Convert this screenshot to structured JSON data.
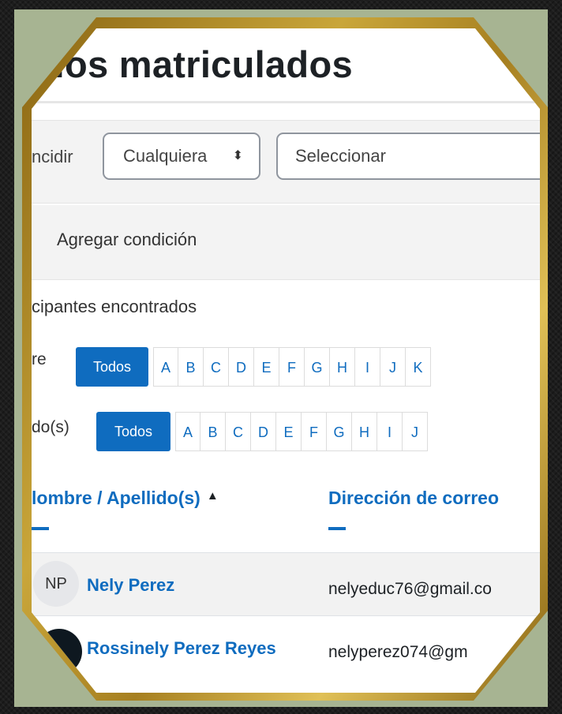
{
  "page": {
    "title": "rios matriculados"
  },
  "filter": {
    "match_label": "ncidir",
    "match_select_value": "Cualquiera",
    "condition_select_value": "Seleccionar",
    "add_condition": "Agregar condición"
  },
  "participants": {
    "found_text": "cipantes encontrados",
    "first_name_label": "re",
    "last_name_label": "do(s)",
    "all_label": "Todos",
    "first_name_letters": [
      "A",
      "B",
      "C",
      "D",
      "E",
      "F",
      "G",
      "H",
      "I",
      "J",
      "K"
    ],
    "last_name_letters": [
      "A",
      "B",
      "C",
      "D",
      "E",
      "F",
      "G",
      "H",
      "I",
      "J"
    ]
  },
  "table": {
    "col_name": "lombre / Apellido(s)",
    "col_email": "Dirección de correo",
    "sort_indicator": "▲",
    "rows": [
      {
        "initials": "NP",
        "name": "Nely Perez",
        "email": "nelyeduc76@gmail.co"
      },
      {
        "initials": "",
        "name": "Rossinely Perez Reyes",
        "email": "nelyperez074@gm"
      }
    ]
  },
  "colors": {
    "link_blue": "#0f6cbf",
    "frame_gold": "#c9a63a",
    "mat_green": "#a7b492"
  },
  "icons": {
    "select_caret": "up-down-caret-icon"
  }
}
